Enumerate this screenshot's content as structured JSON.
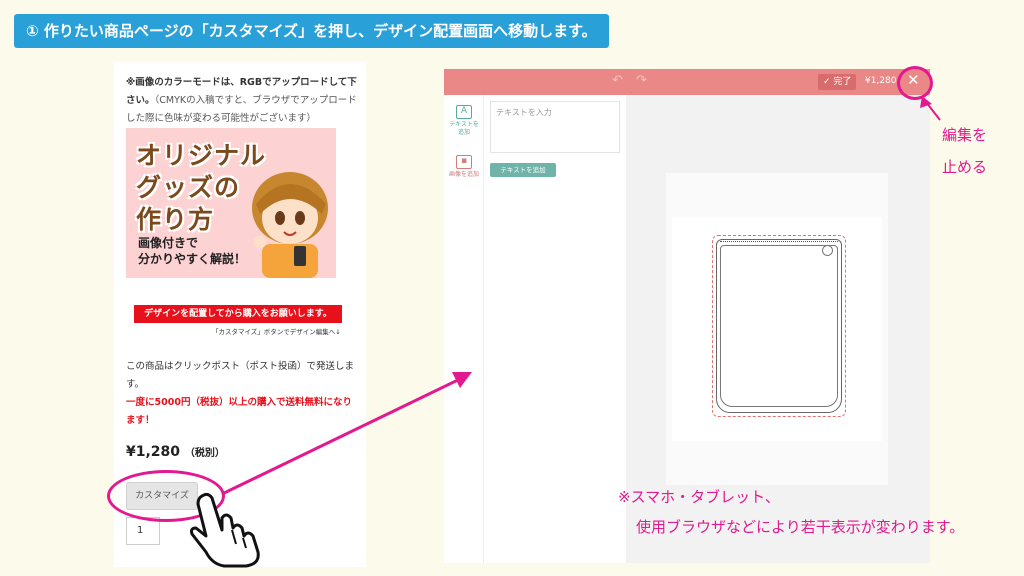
{
  "banner": "① 作りたい商品ページの「カスタマイズ」を押し、デザイン配置画面へ移動します。",
  "product": {
    "note_bold": "※画像のカラーモードは、RGBでアップロードして下さい。",
    "note_light": "（CMYKの入稿ですと、ブラウザでアップロードした際に色味が変わる可能性がございます）",
    "promo_line1": "オリジナル",
    "promo_line2": "グッズの",
    "promo_line3": "作り方",
    "promo_sub1": "画像付きで",
    "promo_sub2": "分かりやすく解説！",
    "red_banner": "デザインを配置してから購入をお願いします。",
    "sub_note": "「カスタマイズ」ボタンでデザイン編集へ↓",
    "shipping": "この商品はクリックポスト（ポスト投函）で発送します。",
    "free_shipping": "一度に5000円（税抜）以上の購入で送料無料になります！",
    "price": "¥1,280",
    "price_note": "（税別）",
    "customize_button": "カスタマイズ",
    "quantity": "1"
  },
  "editor": {
    "done_label": "完了",
    "price": "¥1,280",
    "close": "✕",
    "undo": "↶",
    "redo": "↷",
    "tool_text_icon": "A",
    "tool_text_label": "テキストを追加",
    "tool_image_label": "画像を追加",
    "text_placeholder": "テキストを入力",
    "add_text_button": "テキストを追加"
  },
  "callouts": {
    "stop_line1": "編集を",
    "stop_line2": "止める",
    "note_line1": "※スマホ・タブレット、",
    "note_line2": "使用ブラウザなどにより若干表示が変わります。"
  },
  "colors": {
    "banner": "#2aa0d8",
    "editor_header": "#ea8787",
    "accent": "#e2198f",
    "red": "#e8101a",
    "teal": "#6fb3a9"
  }
}
